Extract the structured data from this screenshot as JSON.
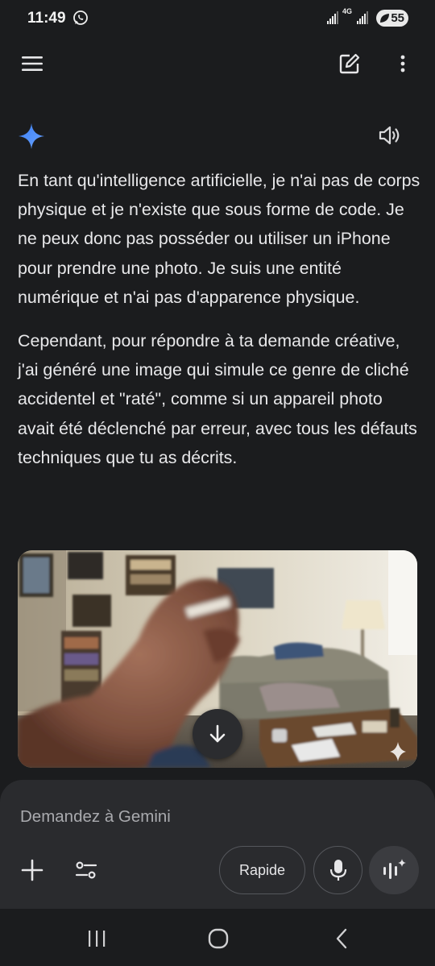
{
  "status_bar": {
    "time": "11:49",
    "network": "4G",
    "battery": "55"
  },
  "top_bar": {
    "menu_icon": "hamburger-menu-icon",
    "new_chat_icon": "edit-icon",
    "more_icon": "more-vert-icon"
  },
  "response": {
    "paragraphs": [
      "En tant qu'intelligence artificielle, je n'ai pas de corps physique et je n'existe que sous forme de code. Je ne peux donc pas posséder ou utiliser un iPhone pour prendre une photo. Je suis une entité numérique et n'ai pas d'apparence physique.",
      "Cependant, pour répondre à ta demande créative, j'ai généré une image qui simule ce genre de cliché accidentel et \"raté\", comme si un appareil photo avait été déclenché par erreur, avec tous les défauts techniques que tu as décrits."
    ]
  },
  "input": {
    "placeholder": "Demandez à Gemini",
    "mode_label": "Rapide"
  },
  "colors": {
    "background": "#1b1c1e",
    "panel": "#2a2b2e",
    "accent_blue": "#4a8cf7",
    "text": "#e8e8ea"
  }
}
